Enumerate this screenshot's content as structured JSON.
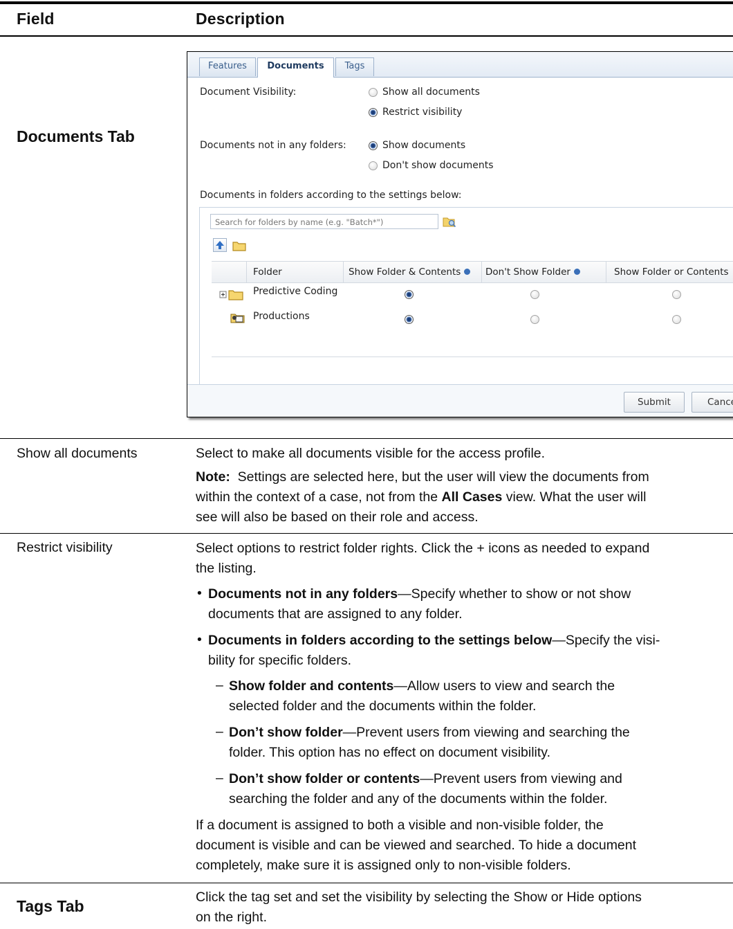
{
  "header": {
    "field": "Field",
    "description": "Description"
  },
  "documents_tab_row": {
    "label": "Documents Tab",
    "screenshot": {
      "tabs": [
        "Features",
        "Documents",
        "Tags"
      ],
      "active_tab": "Documents",
      "document_visibility_label": "Document Visibility:",
      "show_all_documents": "Show all documents",
      "restrict_visibility": "Restrict visibility",
      "not_in_folders_label": "Documents not in any folders:",
      "show_documents": "Show documents",
      "dont_show_documents": "Don't show documents",
      "in_folders_label": "Documents in folders according to the settings below:",
      "search_placeholder": "Search for folders by name (e.g. \"Batch*\")",
      "columns": [
        "Folder",
        "Show Folder & Contents",
        "Don't Show Folder",
        "Show Folder or Contents"
      ],
      "rows": [
        {
          "name": "Predictive Coding",
          "selected": "Show Folder & Contents"
        },
        {
          "name": "Productions",
          "selected": "Show Folder & Contents"
        }
      ],
      "submit": "Submit",
      "cancel": "Cance"
    }
  },
  "rows": {
    "show_all": {
      "field": "Show all documents",
      "desc": "Select to make all documents visible for the access profile.",
      "note_label": "Note:",
      "note_l1": "Settings are selected here, but the user will view the documents from",
      "note_l2a": "within the context of a case, not from the ",
      "note_l2b": "All Cases",
      "note_l2c": " view. What the user will",
      "note_l3": "see will also be based on their role and access."
    },
    "restrict": {
      "field": "Restrict visibility",
      "intro_l1": "Select options to restrict folder rights. Click the + icons as needed to expand",
      "intro_l2": "the listing.",
      "b1_bold": "Documents not in any folders",
      "b1_l1": "—Specify whether to show or not show",
      "b1_l2": "documents that are assigned to any folder.",
      "b2_bold": "Documents in folders according to the settings below",
      "b2_l1": "—Specify the visi-",
      "b2_l2": "bility for specific folders.",
      "s1_bold": "Show folder and contents",
      "s1_l1": "—Allow users to view and search the",
      "s1_l2": "selected folder and the documents within the folder.",
      "s2_bold": "Don’t show folder",
      "s2_l1": "—Prevent users from viewing and searching the",
      "s2_l2": "folder. This option has no effect on document visibility.",
      "s3_bold": "Don’t show folder or contents",
      "s3_l1": "—Prevent users from viewing and",
      "s3_l2": "searching the folder and any of the documents within the folder.",
      "out_l1": "If a document is assigned to both a visible and non-visible folder, the",
      "out_l2": "document is visible and can be viewed and searched. To hide a document",
      "out_l3": "completely, make sure it is assigned only to non-visible folders."
    },
    "tags": {
      "label": "Tags Tab",
      "l1": "Click the tag set and set the visibility by selecting the Show or Hide options",
      "l2": "on the right."
    }
  },
  "glyphs": {
    "bullet": "•",
    "dash": "–"
  }
}
